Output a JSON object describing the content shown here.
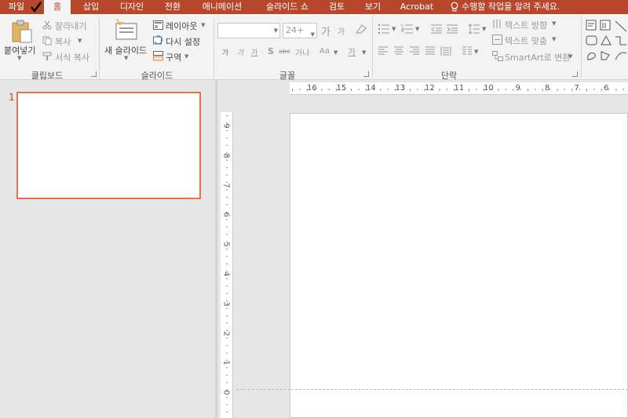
{
  "tabs": [
    {
      "label": "파일"
    },
    {
      "label": "홈"
    },
    {
      "label": "삽입"
    },
    {
      "label": "디자인"
    },
    {
      "label": "전환"
    },
    {
      "label": "애니메이션"
    },
    {
      "label": "슬라이드 쇼"
    },
    {
      "label": "검토"
    },
    {
      "label": "보기"
    },
    {
      "label": "Acrobat"
    }
  ],
  "tell_me": "수행할 작업을 알려 주세요.",
  "clipboard": {
    "paste": "붙여넣기",
    "cut": "잘라내기",
    "copy": "복사",
    "format_painter": "서식 복사",
    "label": "클립보드"
  },
  "slides_group": {
    "new_slide_line1": "새 슬라이드",
    "layout": "레이아웃",
    "reset": "다시 설정",
    "section": "구역",
    "label": "슬라이드"
  },
  "font_group": {
    "font_name": "",
    "font_size": "24+",
    "grow": "가",
    "shrink": "가",
    "bold": "가",
    "italic": "가",
    "underline": "가",
    "strike": "S",
    "spacing": "가나",
    "case": "Aa",
    "color": "가",
    "label": "글꼴"
  },
  "paragraph_group": {
    "text_direction": "텍스트 방향",
    "align_text": "텍스트 맞춤",
    "smartart": "SmartArt로 변환",
    "label": "단락"
  },
  "thumbnails": [
    {
      "number": "1"
    }
  ],
  "ruler": {
    "horizontal": [
      "16",
      "15",
      "14",
      "13",
      "12",
      "11",
      "10",
      "9",
      "8",
      "7",
      "6"
    ],
    "vertical": [
      "9",
      "8",
      "7",
      "6",
      "5",
      "4",
      "3",
      "2",
      "1",
      "0"
    ]
  },
  "colors": {
    "accent": "#b7472a",
    "ribbon_bg": "#f3f3f3",
    "thumb_border": "#e5714d",
    "workspace_bg": "#e6e6e6"
  }
}
